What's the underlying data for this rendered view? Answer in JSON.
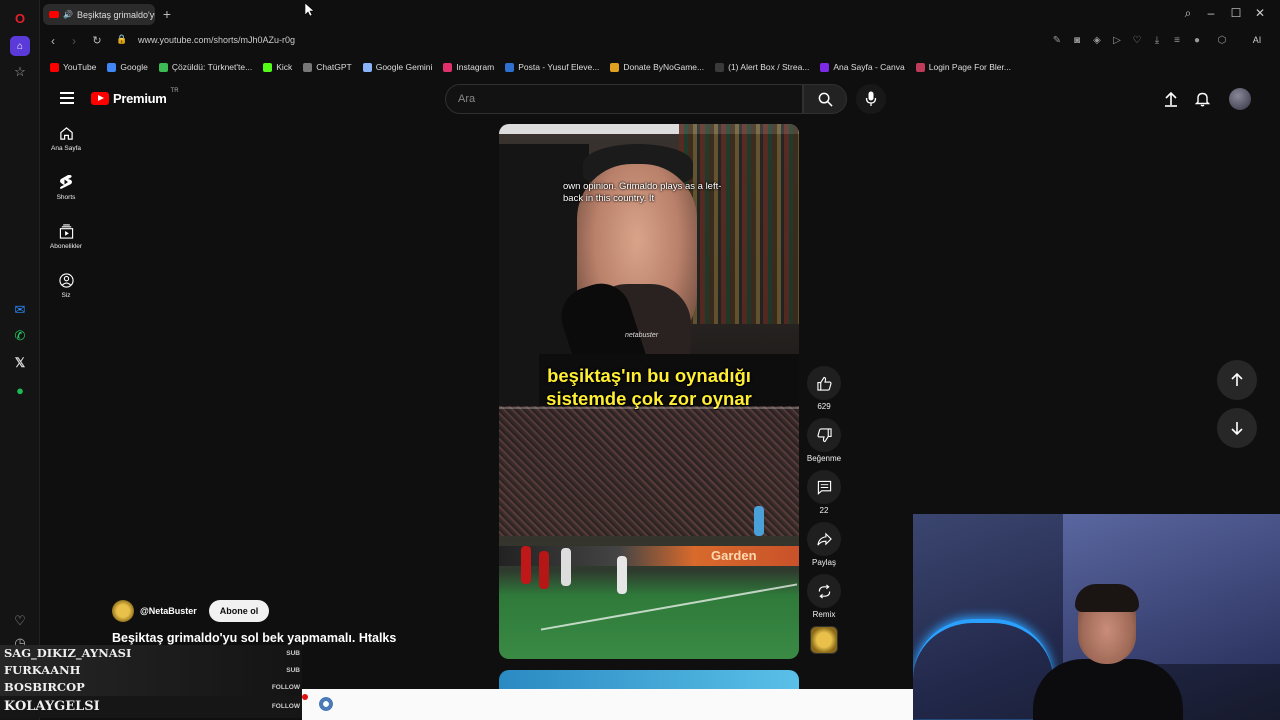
{
  "browser": {
    "tab_title": "Beşiktaş grimaldo'yu",
    "url": "www.youtube.com/shorts/mJh0AZu-r0g",
    "bookmarks": [
      "YouTube",
      "Google",
      "Çözüldü: Türknet'te...",
      "Kick",
      "ChatGPT",
      "Google Gemini",
      "Instagram",
      "Posta - Yusuf Eleve...",
      "Donate ByNoGame...",
      "(1) Alert Box / Strea...",
      "Ana Sayfa - Canva",
      "Login Page For Bler..."
    ],
    "bookmark_colors": [
      "#ff0000",
      "#4285f4",
      "#3cba54",
      "#53fc18",
      "#777777",
      "#8ab4f8",
      "#e1306c",
      "#2f6fd0",
      "#e0a020",
      "#3a3a3a",
      "#7d2ae8",
      "#c03a5a"
    ],
    "ai_label": "AI"
  },
  "youtube": {
    "logo_text": "Premium",
    "logo_region": "TR",
    "search_placeholder": "Ara",
    "nav": [
      {
        "label": "Ana Sayfa",
        "icon": "home-icon"
      },
      {
        "label": "Shorts",
        "icon": "shorts-icon"
      },
      {
        "label": "Abonelikler",
        "icon": "subscriptions-icon"
      },
      {
        "label": "Siz",
        "icon": "you-icon"
      }
    ]
  },
  "short": {
    "caption_en": "own opinion.  Grimaldo plays as a left-back in this country.  It",
    "watermark": "netabuster",
    "caption_tr_line1": "beşiktaş'ın bu oynadığı",
    "caption_tr_line2": "sistemde çok zor oynar",
    "ad_text": "Garden",
    "channel_name": "@NetaBuster",
    "subscribe_label": "Abone ol",
    "title": "Beşiktaş grimaldo'yu sol bek yapmamalı. Htalks",
    "actions": {
      "like_count": "629",
      "dislike_label": "Beğenme",
      "comment_count": "22",
      "share_label": "Paylaş",
      "remix_label": "Remix"
    }
  },
  "stream_overlay": {
    "alerts": [
      {
        "name": "SAG_DIKIZ_AYNASI",
        "tag": "SUB"
      },
      {
        "name": "FURKAANH",
        "tag": "SUB"
      },
      {
        "name": "BOSBIRCOP",
        "tag": "FOLLOW"
      },
      {
        "name": "KOLAYGELSI",
        "tag": "FOLLOW"
      }
    ]
  }
}
